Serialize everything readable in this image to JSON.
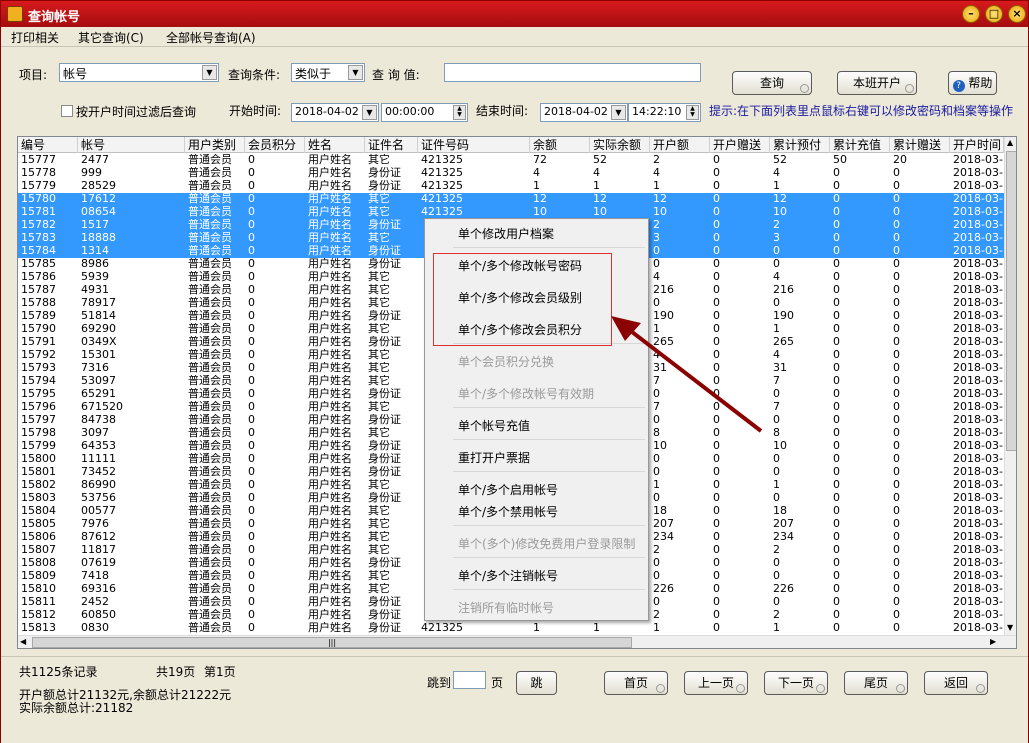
{
  "window": {
    "title": "查询帐号"
  },
  "menu": [
    "打印相关",
    "其它查询(C)",
    "全部帐号查询(A)"
  ],
  "query": {
    "item_label": "项目:",
    "item_value": "帐号",
    "cond_label": "查询条件:",
    "cond_value": "类似于",
    "value_label": "查 询 值:",
    "value_input": "",
    "query_button": "查询",
    "shift_button": "本班开户",
    "help_button": "帮助",
    "filter_checkbox": "按开户时间过滤后查询",
    "start_label": "开始时间:",
    "start_date": "2018-04-02",
    "start_time": "00:00:00",
    "end_label": "结束时间:",
    "end_date": "2018-04-02",
    "end_time": "14:22:10",
    "hint": "提示:在下面列表里点鼠标右键可以修改密码和档案等操作"
  },
  "grid": {
    "columns": [
      "编号",
      "帐号",
      "用户类别",
      "会员积分",
      "姓名",
      "证件名",
      "证件号码",
      "余额",
      "实际余额",
      "开户额",
      "开户赠送",
      "累计预付",
      "累计充值",
      "累计赠送",
      "开户时间"
    ],
    "rows": [
      {
        "id": "15777",
        "acct": "2477",
        "cat": "普通会员",
        "pts": "0",
        "name": "用户姓名",
        "doc": "其它",
        "docno": "421325",
        "bal": "72",
        "real": "52",
        "open": "2",
        "gift": "0",
        "pre": "52",
        "chg": "50",
        "tgift": "20",
        "time": "2018-03-",
        "sel": false
      },
      {
        "id": "15778",
        "acct": "999",
        "cat": "普通会员",
        "pts": "0",
        "name": "用户姓名",
        "doc": "身份证",
        "docno": "421325",
        "bal": "4",
        "real": "4",
        "open": "4",
        "gift": "0",
        "pre": "4",
        "chg": "0",
        "tgift": "0",
        "time": "2018-03-",
        "sel": false
      },
      {
        "id": "15779",
        "acct": "28529",
        "cat": "普通会员",
        "pts": "0",
        "name": "用户姓名",
        "doc": "身份证",
        "docno": "421325",
        "bal": "1",
        "real": "1",
        "open": "1",
        "gift": "0",
        "pre": "1",
        "chg": "0",
        "tgift": "0",
        "time": "2018-03-",
        "sel": false
      },
      {
        "id": "15780",
        "acct": "17612",
        "cat": "普通会员",
        "pts": "0",
        "name": "用户姓名",
        "doc": "其它",
        "docno": "421325",
        "bal": "12",
        "real": "12",
        "open": "12",
        "gift": "0",
        "pre": "12",
        "chg": "0",
        "tgift": "0",
        "time": "2018-03-",
        "sel": true
      },
      {
        "id": "15781",
        "acct": "08654",
        "cat": "普通会员",
        "pts": "0",
        "name": "用户姓名",
        "doc": "其它",
        "docno": "421325",
        "bal": "10",
        "real": "10",
        "open": "10",
        "gift": "0",
        "pre": "10",
        "chg": "0",
        "tgift": "0",
        "time": "2018-03-",
        "sel": true
      },
      {
        "id": "15782",
        "acct": "1517",
        "cat": "普通会员",
        "pts": "0",
        "name": "用户姓名",
        "doc": "身份证",
        "docno": "",
        "bal": "",
        "real": "",
        "open": "2",
        "gift": "0",
        "pre": "2",
        "chg": "0",
        "tgift": "0",
        "time": "2018-03-",
        "sel": true
      },
      {
        "id": "15783",
        "acct": "18888",
        "cat": "普通会员",
        "pts": "0",
        "name": "用户姓名",
        "doc": "其它",
        "docno": "",
        "bal": "",
        "real": "",
        "open": "3",
        "gift": "0",
        "pre": "3",
        "chg": "0",
        "tgift": "0",
        "time": "2018-03-",
        "sel": true
      },
      {
        "id": "15784",
        "acct": "1314",
        "cat": "普通会员",
        "pts": "0",
        "name": "用户姓名",
        "doc": "身份证",
        "docno": "",
        "bal": "",
        "real": "",
        "open": "0",
        "gift": "0",
        "pre": "0",
        "chg": "0",
        "tgift": "0",
        "time": "2018-03-",
        "sel": true
      },
      {
        "id": "15785",
        "acct": "8986",
        "cat": "普通会员",
        "pts": "0",
        "name": "用户姓名",
        "doc": "身份证",
        "docno": "",
        "bal": "",
        "real": "",
        "open": "0",
        "gift": "0",
        "pre": "0",
        "chg": "0",
        "tgift": "0",
        "time": "2018-03-",
        "sel": false
      },
      {
        "id": "15786",
        "acct": "5939",
        "cat": "普通会员",
        "pts": "0",
        "name": "用户姓名",
        "doc": "其它",
        "docno": "",
        "bal": "",
        "real": "",
        "open": "4",
        "gift": "0",
        "pre": "4",
        "chg": "0",
        "tgift": "0",
        "time": "2018-03-",
        "sel": false
      },
      {
        "id": "15787",
        "acct": "4931",
        "cat": "普通会员",
        "pts": "0",
        "name": "用户姓名",
        "doc": "其它",
        "docno": "",
        "bal": "",
        "real": "",
        "open": "216",
        "gift": "0",
        "pre": "216",
        "chg": "0",
        "tgift": "0",
        "time": "2018-03-",
        "sel": false
      },
      {
        "id": "15788",
        "acct": "78917",
        "cat": "普通会员",
        "pts": "0",
        "name": "用户姓名",
        "doc": "其它",
        "docno": "",
        "bal": "",
        "real": "",
        "open": "0",
        "gift": "0",
        "pre": "0",
        "chg": "0",
        "tgift": "0",
        "time": "2018-03-",
        "sel": false
      },
      {
        "id": "15789",
        "acct": "51814",
        "cat": "普通会员",
        "pts": "0",
        "name": "用户姓名",
        "doc": "身份证",
        "docno": "",
        "bal": "",
        "real": "",
        "open": "190",
        "gift": "0",
        "pre": "190",
        "chg": "0",
        "tgift": "0",
        "time": "2018-03-",
        "sel": false
      },
      {
        "id": "15790",
        "acct": "69290",
        "cat": "普通会员",
        "pts": "0",
        "name": "用户姓名",
        "doc": "其它",
        "docno": "",
        "bal": "",
        "real": "",
        "open": "1",
        "gift": "0",
        "pre": "1",
        "chg": "0",
        "tgift": "0",
        "time": "2018-03-",
        "sel": false
      },
      {
        "id": "15791",
        "acct": "0349X",
        "cat": "普通会员",
        "pts": "0",
        "name": "用户姓名",
        "doc": "身份证",
        "docno": "",
        "bal": "",
        "real": "",
        "open": "265",
        "gift": "0",
        "pre": "265",
        "chg": "0",
        "tgift": "0",
        "time": "2018-03-",
        "sel": false
      },
      {
        "id": "15792",
        "acct": "15301",
        "cat": "普通会员",
        "pts": "0",
        "name": "用户姓名",
        "doc": "其它",
        "docno": "",
        "bal": "",
        "real": "",
        "open": "4",
        "gift": "0",
        "pre": "4",
        "chg": "0",
        "tgift": "0",
        "time": "2018-03-",
        "sel": false
      },
      {
        "id": "15793",
        "acct": "7316",
        "cat": "普通会员",
        "pts": "0",
        "name": "用户姓名",
        "doc": "其它",
        "docno": "",
        "bal": "",
        "real": "",
        "open": "31",
        "gift": "0",
        "pre": "31",
        "chg": "0",
        "tgift": "0",
        "time": "2018-03-",
        "sel": false
      },
      {
        "id": "15794",
        "acct": "53097",
        "cat": "普通会员",
        "pts": "0",
        "name": "用户姓名",
        "doc": "其它",
        "docno": "",
        "bal": "",
        "real": "",
        "open": "7",
        "gift": "0",
        "pre": "7",
        "chg": "0",
        "tgift": "0",
        "time": "2018-03-",
        "sel": false
      },
      {
        "id": "15795",
        "acct": "65291",
        "cat": "普通会员",
        "pts": "0",
        "name": "用户姓名",
        "doc": "身份证",
        "docno": "",
        "bal": "",
        "real": "",
        "open": "0",
        "gift": "0",
        "pre": "0",
        "chg": "0",
        "tgift": "0",
        "time": "2018-03-",
        "sel": false
      },
      {
        "id": "15796",
        "acct": "671520",
        "cat": "普通会员",
        "pts": "0",
        "name": "用户姓名",
        "doc": "其它",
        "docno": "",
        "bal": "",
        "real": "",
        "open": "7",
        "gift": "0",
        "pre": "7",
        "chg": "0",
        "tgift": "0",
        "time": "2018-03-",
        "sel": false
      },
      {
        "id": "15797",
        "acct": "84738",
        "cat": "普通会员",
        "pts": "0",
        "name": "用户姓名",
        "doc": "身份证",
        "docno": "",
        "bal": "",
        "real": "",
        "open": "0",
        "gift": "0",
        "pre": "0",
        "chg": "0",
        "tgift": "0",
        "time": "2018-03-",
        "sel": false
      },
      {
        "id": "15798",
        "acct": "3097",
        "cat": "普通会员",
        "pts": "0",
        "name": "用户姓名",
        "doc": "其它",
        "docno": "",
        "bal": "",
        "real": "",
        "open": "8",
        "gift": "0",
        "pre": "8",
        "chg": "0",
        "tgift": "0",
        "time": "2018-03-",
        "sel": false
      },
      {
        "id": "15799",
        "acct": "64353",
        "cat": "普通会员",
        "pts": "0",
        "name": "用户姓名",
        "doc": "身份证",
        "docno": "",
        "bal": "",
        "real": "",
        "open": "10",
        "gift": "0",
        "pre": "10",
        "chg": "0",
        "tgift": "0",
        "time": "2018-03-",
        "sel": false
      },
      {
        "id": "15800",
        "acct": "11111",
        "cat": "普通会员",
        "pts": "0",
        "name": "用户姓名",
        "doc": "身份证",
        "docno": "",
        "bal": "",
        "real": "",
        "open": "0",
        "gift": "0",
        "pre": "0",
        "chg": "0",
        "tgift": "0",
        "time": "2018-03-",
        "sel": false
      },
      {
        "id": "15801",
        "acct": "73452",
        "cat": "普通会员",
        "pts": "0",
        "name": "用户姓名",
        "doc": "身份证",
        "docno": "",
        "bal": "",
        "real": "",
        "open": "0",
        "gift": "0",
        "pre": "0",
        "chg": "0",
        "tgift": "0",
        "time": "2018-03-",
        "sel": false
      },
      {
        "id": "15802",
        "acct": "86990",
        "cat": "普通会员",
        "pts": "0",
        "name": "用户姓名",
        "doc": "其它",
        "docno": "",
        "bal": "",
        "real": "",
        "open": "1",
        "gift": "0",
        "pre": "1",
        "chg": "0",
        "tgift": "0",
        "time": "2018-03-",
        "sel": false
      },
      {
        "id": "15803",
        "acct": "53756",
        "cat": "普通会员",
        "pts": "0",
        "name": "用户姓名",
        "doc": "身份证",
        "docno": "",
        "bal": "",
        "real": "",
        "open": "0",
        "gift": "0",
        "pre": "0",
        "chg": "0",
        "tgift": "0",
        "time": "2018-03-",
        "sel": false
      },
      {
        "id": "15804",
        "acct": "00577",
        "cat": "普通会员",
        "pts": "0",
        "name": "用户姓名",
        "doc": "其它",
        "docno": "",
        "bal": "",
        "real": "",
        "open": "18",
        "gift": "0",
        "pre": "18",
        "chg": "0",
        "tgift": "0",
        "time": "2018-03-",
        "sel": false
      },
      {
        "id": "15805",
        "acct": "7976",
        "cat": "普通会员",
        "pts": "0",
        "name": "用户姓名",
        "doc": "其它",
        "docno": "",
        "bal": "",
        "real": "",
        "open": "207",
        "gift": "0",
        "pre": "207",
        "chg": "0",
        "tgift": "0",
        "time": "2018-03-",
        "sel": false
      },
      {
        "id": "15806",
        "acct": "87612",
        "cat": "普通会员",
        "pts": "0",
        "name": "用户姓名",
        "doc": "其它",
        "docno": "",
        "bal": "",
        "real": "",
        "open": "234",
        "gift": "0",
        "pre": "234",
        "chg": "0",
        "tgift": "0",
        "time": "2018-03-",
        "sel": false
      },
      {
        "id": "15807",
        "acct": "11817",
        "cat": "普通会员",
        "pts": "0",
        "name": "用户姓名",
        "doc": "其它",
        "docno": "",
        "bal": "",
        "real": "",
        "open": "2",
        "gift": "0",
        "pre": "2",
        "chg": "0",
        "tgift": "0",
        "time": "2018-03-",
        "sel": false
      },
      {
        "id": "15808",
        "acct": "07619",
        "cat": "普通会员",
        "pts": "0",
        "name": "用户姓名",
        "doc": "身份证",
        "docno": "",
        "bal": "",
        "real": "",
        "open": "0",
        "gift": "0",
        "pre": "0",
        "chg": "0",
        "tgift": "0",
        "time": "2018-03-",
        "sel": false
      },
      {
        "id": "15809",
        "acct": "7418",
        "cat": "普通会员",
        "pts": "0",
        "name": "用户姓名",
        "doc": "其它",
        "docno": "",
        "bal": "",
        "real": "",
        "open": "0",
        "gift": "0",
        "pre": "0",
        "chg": "0",
        "tgift": "0",
        "time": "2018-03-",
        "sel": false
      },
      {
        "id": "15810",
        "acct": "69316",
        "cat": "普通会员",
        "pts": "0",
        "name": "用户姓名",
        "doc": "其它",
        "docno": "",
        "bal": "",
        "real": "",
        "open": "226",
        "gift": "0",
        "pre": "226",
        "chg": "0",
        "tgift": "0",
        "time": "2018-03-",
        "sel": false
      },
      {
        "id": "15811",
        "acct": "2452",
        "cat": "普通会员",
        "pts": "0",
        "name": "用户姓名",
        "doc": "身份证",
        "docno": "",
        "bal": "",
        "real": "",
        "open": "0",
        "gift": "0",
        "pre": "0",
        "chg": "0",
        "tgift": "0",
        "time": "2018-03-",
        "sel": false
      },
      {
        "id": "15812",
        "acct": "60850",
        "cat": "普通会员",
        "pts": "0",
        "name": "用户姓名",
        "doc": "身份证",
        "docno": "",
        "bal": "",
        "real": "",
        "open": "2",
        "gift": "0",
        "pre": "2",
        "chg": "0",
        "tgift": "0",
        "time": "2018-03-",
        "sel": false
      },
      {
        "id": "15813",
        "acct": "0830",
        "cat": "普通会员",
        "pts": "0",
        "name": "用户姓名",
        "doc": "身份证",
        "docno": "421325",
        "bal": "1",
        "real": "1",
        "open": "1",
        "gift": "0",
        "pre": "1",
        "chg": "0",
        "tgift": "0",
        "time": "2018-03-",
        "sel": false
      }
    ]
  },
  "context_menu": [
    {
      "label": "单个修改用户档案",
      "enabled": true
    },
    {
      "label": "单个/多个修改帐号密码",
      "enabled": true
    },
    {
      "label": "单个/多个修改会员级别",
      "enabled": true
    },
    {
      "label": "单个/多个修改会员积分",
      "enabled": true
    },
    {
      "label": "单个会员积分兑换",
      "enabled": false
    },
    {
      "label": "单个/多个修改帐号有效期",
      "enabled": false
    },
    {
      "label": "单个帐号充值",
      "enabled": true
    },
    {
      "label": "重打开户票据",
      "enabled": true
    },
    {
      "label": "单个/多个启用帐号",
      "enabled": true
    },
    {
      "label": "单个/多个禁用帐号",
      "enabled": true
    },
    {
      "label": "单个(多个)修改免费用户登录限制",
      "enabled": false
    },
    {
      "label": "单个/多个注销帐号",
      "enabled": true
    },
    {
      "label": "注销所有临时帐号",
      "enabled": false
    }
  ],
  "footer": {
    "total_records": "共1125条记录",
    "total_pages": "共19页",
    "current_page": "第1页",
    "summary_line1": "开户额总计21132元,余额总计21222元",
    "summary_line2": "实际余额总计:21182",
    "jump_label": "跳到",
    "page_unit": "页",
    "jump_button": "跳",
    "first_button": "首页",
    "prev_button": "上一页",
    "next_button": "下一页",
    "last_button": "尾页",
    "back_button": "返回"
  },
  "colors": {
    "accent": "#3399ff",
    "title": "#c0141a",
    "hint": "#1a1aa0",
    "highlight": "#e03030",
    "arrow": "#8b0000"
  }
}
